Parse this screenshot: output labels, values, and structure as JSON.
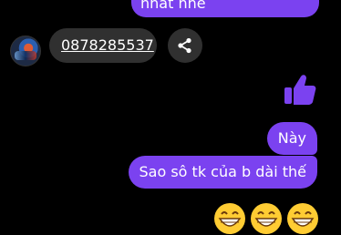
{
  "messages": {
    "top_partial": "nhất nhé",
    "phone_number": "0878285537",
    "sent_1": "Này",
    "sent_2": "Sao sô tk của b dài thế",
    "emoji_count": 3
  },
  "icons": {
    "share": "share-icon",
    "like": "thumbs-up-icon",
    "emoji": "grinning-face-icon"
  },
  "colors": {
    "accent": "#7b42f0",
    "pill": "#303030",
    "background": "#000000"
  }
}
